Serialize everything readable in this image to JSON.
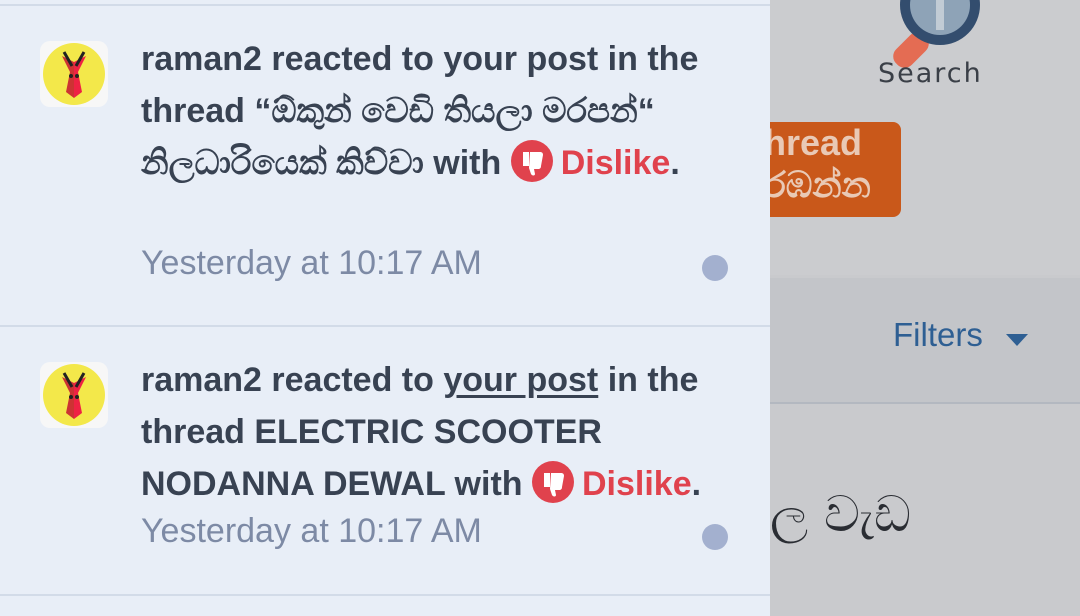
{
  "background": {
    "search_label": "Search",
    "thread_button": {
      "line1": "hread",
      "line2": "රඹන්න"
    },
    "filters_label": "Filters",
    "partial_text": "ල වැඩ"
  },
  "notifications": [
    {
      "user": "raman2",
      "text_before": "raman2 reacted to your post in the thread “ඕකුන් වෙඩි තියලා මරපන්“ නිලධාරියෙක් කිව්වා with ",
      "reaction": "Dislike",
      "time": "Yesterday at 10:17 AM"
    },
    {
      "user": "raman2",
      "lead": "raman2 reacted to ",
      "link": "your post",
      "text_after": " in the thread ELECTRIC SCOOTER NODANNA DEWAL with ",
      "reaction": "Dislike",
      "time": "Yesterday at 10:17 AM"
    }
  ],
  "colors": {
    "panel_bg": "#e8eef7",
    "reaction_red": "#e0424d",
    "unread_dot": "#a3b0cf"
  }
}
